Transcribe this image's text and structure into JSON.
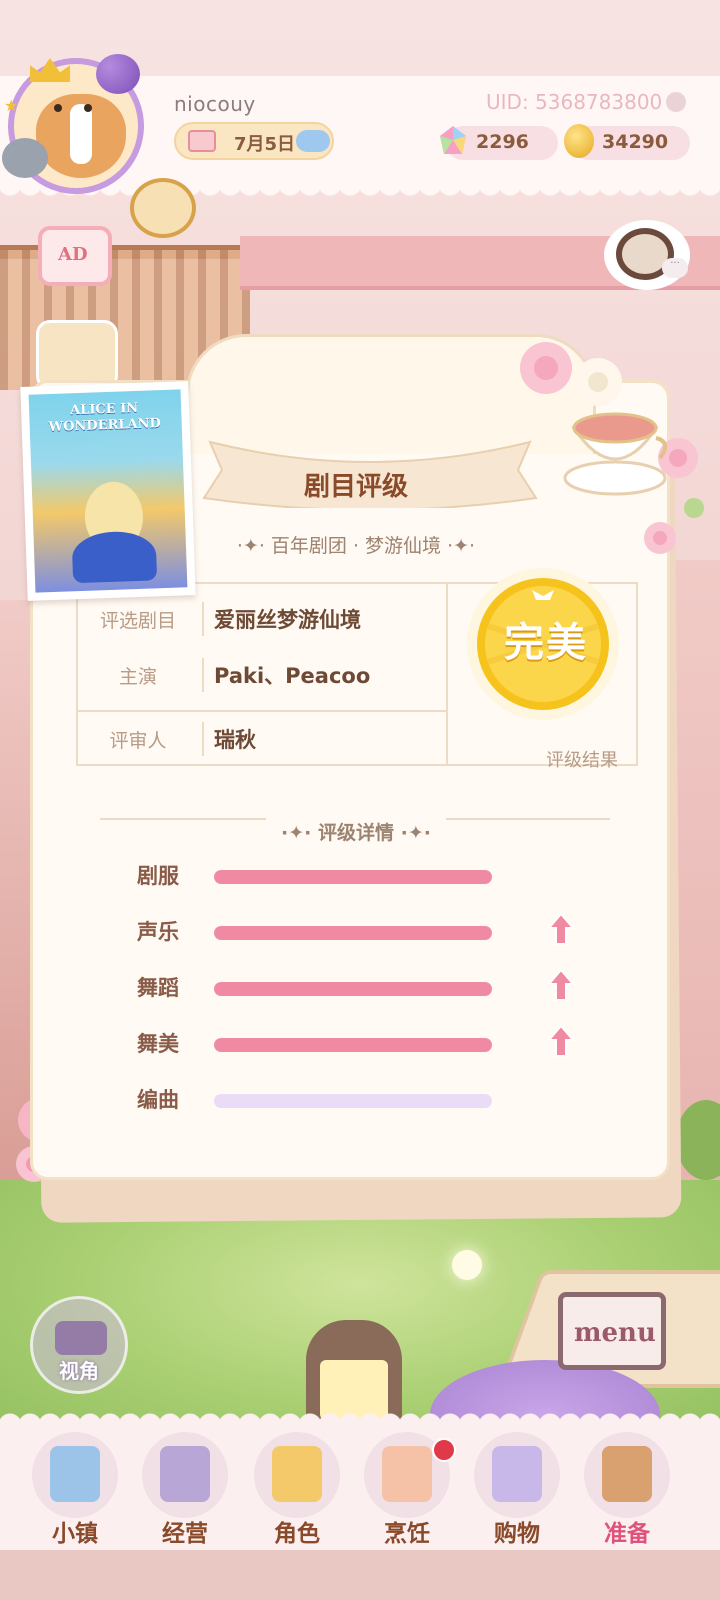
{
  "header": {
    "username": "niocouy",
    "uid": "UID: 5368783800",
    "date": "7月5日",
    "gems": "2296",
    "coins": "34290",
    "ad_label": "AD"
  },
  "card": {
    "title": "剧目评级",
    "subtitle": "·✦· 百年剧团 · 梦游仙境 ·✦·",
    "poster_title": "ALICE IN WONDERLAND",
    "info": [
      {
        "label": "评选剧目",
        "value": "爱丽丝梦游仙境"
      },
      {
        "label": "主演",
        "value": "Paki、Peacoo"
      },
      {
        "label": "评审人",
        "value": "瑞秋"
      }
    ],
    "result": "完美",
    "result_label": "评级结果",
    "detail_title": "·✦· 评级详情 ·✦·",
    "stats": [
      {
        "label": "剧服",
        "level": 1.0,
        "up": false
      },
      {
        "label": "声乐",
        "level": 1.0,
        "up": true
      },
      {
        "label": "舞蹈",
        "level": 1.0,
        "up": true
      },
      {
        "label": "舞美",
        "level": 1.0,
        "up": true
      },
      {
        "label": "编曲",
        "level": 0.0,
        "up": false
      }
    ]
  },
  "controls": {
    "view_label": "视角",
    "menu_label": "menu"
  },
  "nav": [
    {
      "label": "小镇",
      "icon": "map-icon"
    },
    {
      "label": "经营",
      "icon": "bag-lock-icon"
    },
    {
      "label": "角色",
      "icon": "alice-icon"
    },
    {
      "label": "烹饪",
      "icon": "sandwich-icon"
    },
    {
      "label": "购物",
      "icon": "shopping-bag-icon"
    },
    {
      "label": "准备",
      "icon": "basket-icon",
      "active": true
    }
  ],
  "colors": {
    "bar_fill": "#f08aa2",
    "bar_empty": "#eadcf6",
    "active_nav": "#e0527a",
    "result_gold": "#f6c21c"
  }
}
